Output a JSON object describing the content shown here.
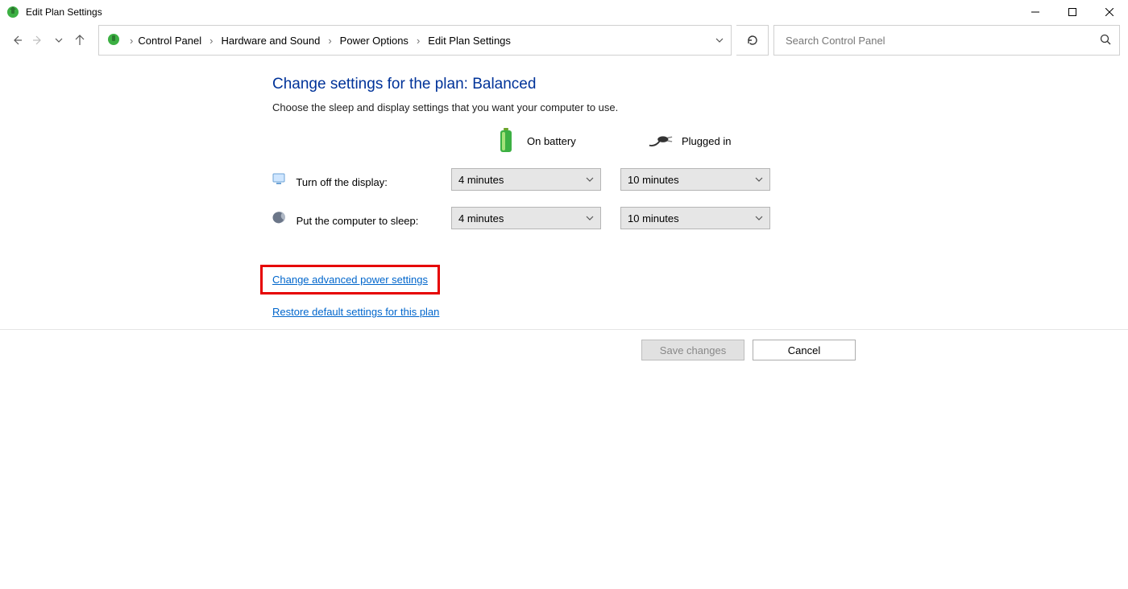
{
  "window": {
    "title": "Edit Plan Settings"
  },
  "breadcrumb": {
    "items": [
      "Control Panel",
      "Hardware and Sound",
      "Power Options",
      "Edit Plan Settings"
    ]
  },
  "search": {
    "placeholder": "Search Control Panel"
  },
  "page": {
    "heading": "Change settings for the plan: Balanced",
    "subtext": "Choose the sleep and display settings that you want your computer to use."
  },
  "columns": {
    "battery": "On battery",
    "plugged": "Plugged in"
  },
  "settings": {
    "display": {
      "label": "Turn off the display:",
      "battery": "4 minutes",
      "plugged": "10 minutes"
    },
    "sleep": {
      "label": "Put the computer to sleep:",
      "battery": "4 minutes",
      "plugged": "10 minutes"
    }
  },
  "links": {
    "advanced": "Change advanced power settings",
    "restore": "Restore default settings for this plan"
  },
  "buttons": {
    "save": "Save changes",
    "cancel": "Cancel"
  }
}
